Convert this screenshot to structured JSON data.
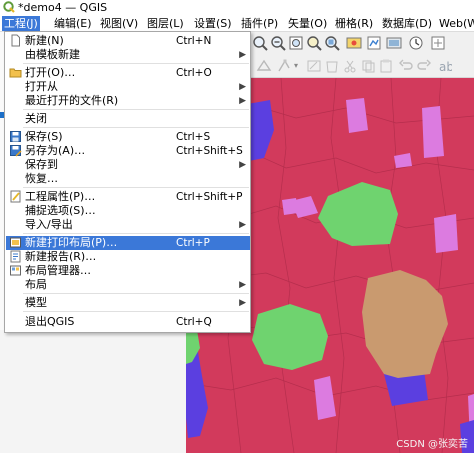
{
  "window": {
    "title": "*demo4 — QGIS"
  },
  "menubar": {
    "items": [
      {
        "label": "工程(J)",
        "active": true
      },
      {
        "label": "编辑(E)"
      },
      {
        "label": "视图(V)"
      },
      {
        "label": "图层(L)"
      },
      {
        "label": "设置(S)"
      },
      {
        "label": "插件(P)"
      },
      {
        "label": "矢量(O)"
      },
      {
        "label": "栅格(R)"
      },
      {
        "label": "数据库(D)"
      },
      {
        "label": "Web(W)"
      }
    ]
  },
  "project_menu": {
    "items": [
      {
        "label": "新建(N)",
        "shortcut": "Ctrl+N",
        "icon": "new-file-icon"
      },
      {
        "label": "由模板新建",
        "submenu": true
      },
      {
        "label": "打开(O)…",
        "shortcut": "Ctrl+O",
        "icon": "open-folder-icon"
      },
      {
        "label": "打开从",
        "submenu": true
      },
      {
        "label": "最近打开的文件(R)",
        "submenu": true
      },
      {
        "label": "关闭"
      },
      {
        "label": "保存(S)",
        "shortcut": "Ctrl+S",
        "icon": "save-icon"
      },
      {
        "label": "另存为(A)…",
        "shortcut": "Ctrl+Shift+S",
        "icon": "save-as-icon"
      },
      {
        "label": "保存到",
        "submenu": true
      },
      {
        "label": "恢复…"
      },
      {
        "label": "工程属性(P)…",
        "shortcut": "Ctrl+Shift+P",
        "icon": "project-properties-icon"
      },
      {
        "label": "捕捉选项(S)…"
      },
      {
        "label": "导入/导出",
        "submenu": true
      },
      {
        "label": "新建打印布局(P)…",
        "shortcut": "Ctrl+P",
        "icon": "new-print-layout-icon",
        "highlighted": true
      },
      {
        "label": "新建报告(R)…",
        "icon": "new-report-icon"
      },
      {
        "label": "布局管理器…",
        "icon": "layout-manager-icon"
      },
      {
        "label": "布局",
        "submenu": true
      },
      {
        "label": "模型",
        "submenu": true
      },
      {
        "label": "退出QGIS",
        "shortcut": "Ctrl+Q"
      }
    ]
  },
  "colors": {
    "menu_highlight": "#3b78d8",
    "map_red": "#d23a5c",
    "map_green": "#6fd36f",
    "map_violet": "#dc7be0",
    "map_blue": "#5b3fe0",
    "map_tan": "#c99a6f"
  },
  "watermark": "CSDN @张奕苦"
}
